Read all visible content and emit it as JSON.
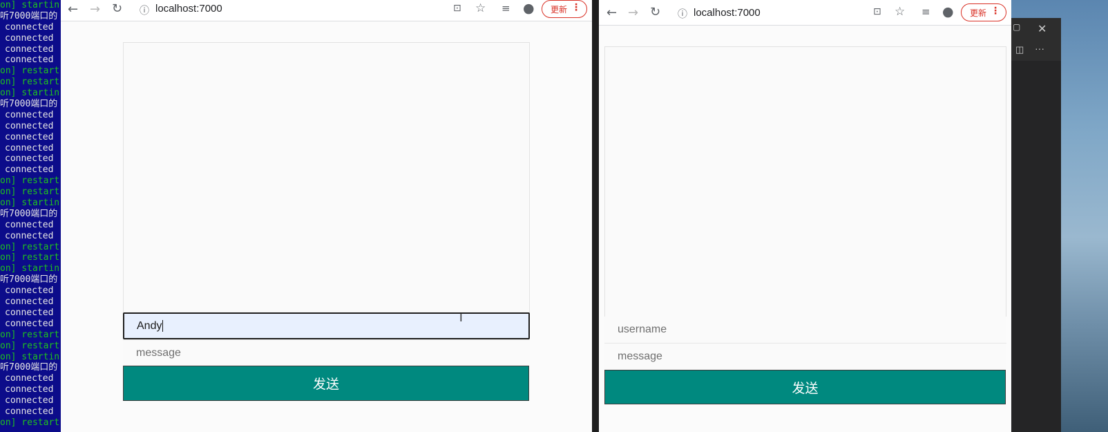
{
  "terminal": {
    "lines": [
      {
        "text": "on] startin",
        "color": "green"
      },
      {
        "text": "听7000端口的",
        "color": "white"
      },
      {
        "text": "connected",
        "color": "gray"
      },
      {
        "text": "connected",
        "color": "gray"
      },
      {
        "text": "connected",
        "color": "gray"
      },
      {
        "text": "connected",
        "color": "gray"
      },
      {
        "text": "on] restart",
        "color": "green"
      },
      {
        "text": "on] restart",
        "color": "green"
      },
      {
        "text": "on] startin",
        "color": "green"
      },
      {
        "text": "听7000端口的",
        "color": "white"
      },
      {
        "text": "connected",
        "color": "gray"
      },
      {
        "text": "connected",
        "color": "gray"
      },
      {
        "text": "connected",
        "color": "gray"
      },
      {
        "text": "connected",
        "color": "gray"
      },
      {
        "text": "connected",
        "color": "gray"
      },
      {
        "text": "connected",
        "color": "gray"
      },
      {
        "text": "on] restart",
        "color": "green"
      },
      {
        "text": "on] restart",
        "color": "green"
      },
      {
        "text": "on] startin",
        "color": "green"
      },
      {
        "text": "听7000端口的",
        "color": "white"
      },
      {
        "text": "connected",
        "color": "gray"
      },
      {
        "text": "connected",
        "color": "gray"
      },
      {
        "text": "on] restart",
        "color": "green"
      },
      {
        "text": "on] restart",
        "color": "green"
      },
      {
        "text": "on] startin",
        "color": "green"
      },
      {
        "text": "听7000端口的",
        "color": "white"
      },
      {
        "text": "connected",
        "color": "gray"
      },
      {
        "text": "connected",
        "color": "gray"
      },
      {
        "text": "connected",
        "color": "gray"
      },
      {
        "text": "connected",
        "color": "gray"
      },
      {
        "text": "on] restart",
        "color": "green"
      },
      {
        "text": "on] restart",
        "color": "green"
      },
      {
        "text": "on] startin",
        "color": "green"
      },
      {
        "text": "听7000端口的",
        "color": "white"
      },
      {
        "text": "connected",
        "color": "gray"
      },
      {
        "text": "connected",
        "color": "gray"
      },
      {
        "text": "connected",
        "color": "gray"
      },
      {
        "text": "connected",
        "color": "gray"
      },
      {
        "text": "on] restart",
        "color": "green"
      }
    ]
  },
  "left_browser": {
    "url": "localhost:7000",
    "update_label": "更新",
    "username_value": "Andy",
    "message_placeholder": "message",
    "send_label": "发送"
  },
  "right_browser": {
    "url": "localhost:7000",
    "update_label": "更新",
    "username_placeholder": "username",
    "message_placeholder": "message",
    "send_label": "发送"
  },
  "colors": {
    "send_button": "#00897f",
    "update_accent": "#d93025",
    "terminal_bg": "#0c0c8a"
  },
  "icons": {
    "nav": [
      "back-icon",
      "forward-icon",
      "reload-icon",
      "info-icon"
    ],
    "toolbar": [
      "translate-icon",
      "star-icon",
      "media-queue-icon",
      "profile-icon",
      "menu-dots-icon"
    ]
  }
}
